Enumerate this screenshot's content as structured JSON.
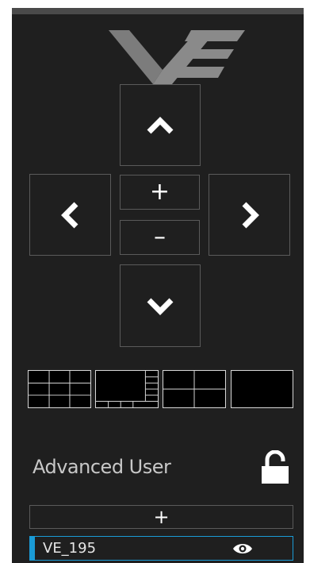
{
  "ptz": {
    "up": {
      "icon": "chevron-up-icon"
    },
    "down": {
      "icon": "chevron-down-icon"
    },
    "left": {
      "icon": "chevron-left-icon"
    },
    "right": {
      "icon": "chevron-right-icon"
    },
    "zoom_in_label": "+",
    "zoom_out_label": "–"
  },
  "layouts": [
    {
      "name": "grid-3x3-layout",
      "icon": "grid-layout-icon"
    },
    {
      "name": "big-plus-small-layout",
      "icon": "featured-layout-icon"
    },
    {
      "name": "quad-layout",
      "icon": "quad-layout-icon"
    },
    {
      "name": "single-layout",
      "icon": "single-layout-icon"
    }
  ],
  "user": {
    "label": "Advanced User",
    "lock_icon": "unlocked-icon"
  },
  "cameras": {
    "add_label": "+",
    "items": [
      {
        "name": "VE_195",
        "icon": "eye-icon",
        "selected": true
      }
    ]
  },
  "colors": {
    "panel": "#1f1f1f",
    "accent": "#1a9bd6",
    "text": "#c8c8c8"
  }
}
